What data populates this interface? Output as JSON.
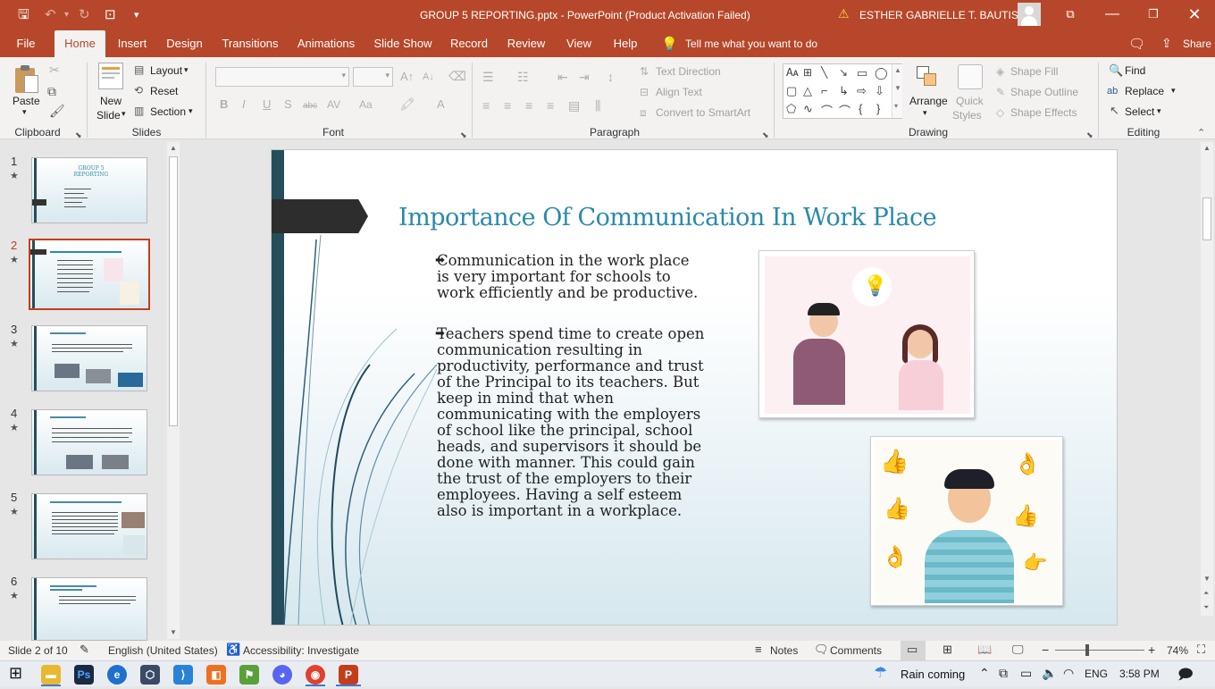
{
  "window": {
    "title": "GROUP 5 REPORTING.pptx  -  PowerPoint (Product Activation Failed)",
    "user": "ESTHER GABRIELLE T. BAUTISTA"
  },
  "tabs": [
    "File",
    "Home",
    "Insert",
    "Design",
    "Transitions",
    "Animations",
    "Slide Show",
    "Record",
    "Review",
    "View",
    "Help"
  ],
  "tell_me": "Tell me what you want to do",
  "share_label": "Share",
  "ribbon": {
    "clipboard": {
      "paste": "Paste",
      "group": "Clipboard"
    },
    "slides": {
      "new_slide_1": "New",
      "new_slide_2": "Slide",
      "layout": "Layout",
      "reset": "Reset",
      "section": "Section",
      "group": "Slides"
    },
    "font": {
      "group": "Font"
    },
    "paragraph": {
      "text_direction": "Text Direction",
      "align_text": "Align Text",
      "convert_smartart": "Convert to SmartArt",
      "group": "Paragraph"
    },
    "drawing": {
      "arrange": "Arrange",
      "quick_styles_1": "Quick",
      "quick_styles_2": "Styles",
      "shape_fill": "Shape Fill",
      "shape_outline": "Shape Outline",
      "shape_effects": "Shape Effects",
      "group": "Drawing"
    },
    "editing": {
      "find": "Find",
      "replace": "Replace",
      "select": "Select",
      "group": "Editing"
    }
  },
  "thumbnails": [
    {
      "num": "1",
      "title": "GROUP 5 REPORTING"
    },
    {
      "num": "2",
      "title": ""
    },
    {
      "num": "3",
      "title": ""
    },
    {
      "num": "4",
      "title": ""
    },
    {
      "num": "5",
      "title": ""
    },
    {
      "num": "6",
      "title": ""
    }
  ],
  "slide": {
    "title": "Importance Of Communication In Work Place",
    "bullets": [
      "Communication in the work place is very important for schools to work efficiently and be productive.",
      "Teachers spend time to create open communication resulting in productivity, performance and trust of the Principal to its teachers. But keep in mind that when communicating with the employers of school like the principal, school heads, and supervisors it should be done with manner. This could gain the trust of the employers to their employees. Having a self esteem also is important in a workplace."
    ]
  },
  "status": {
    "slide_count": "Slide 2 of 10",
    "language": "English (United States)",
    "accessibility": "Accessibility: Investigate",
    "notes": "Notes",
    "comments": "Comments",
    "zoom": "74%"
  },
  "taskbar": {
    "weather": "Rain coming",
    "lang": "ENG",
    "time": "3:58 PM"
  },
  "colors": {
    "accent": "#b7472a",
    "title_teal": "#2a8aaa",
    "slide_bar": "#244e5c"
  }
}
